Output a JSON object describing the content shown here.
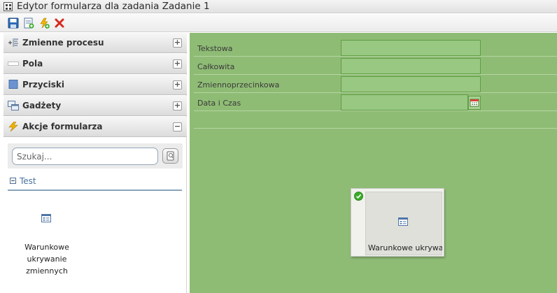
{
  "window": {
    "title": "Edytor formularza dla zadania Zadanie 1"
  },
  "toolbar": {
    "buttons": [
      {
        "icon": "save-icon"
      },
      {
        "icon": "new-form-icon"
      },
      {
        "icon": "add-action-icon"
      },
      {
        "icon": "delete-icon"
      }
    ]
  },
  "sidebar": {
    "sections": [
      {
        "label": "Zmienne procesu",
        "toggle": "+",
        "icon": "process-variables-icon"
      },
      {
        "label": "Pola",
        "toggle": "+",
        "icon": "field-icon"
      },
      {
        "label": "Przyciski",
        "toggle": "+",
        "icon": "button-square-icon"
      },
      {
        "label": "Gadżety",
        "toggle": "+",
        "icon": "gadgets-icon"
      },
      {
        "label": "Akcje formularza",
        "toggle": "−",
        "icon": "lightning-icon"
      }
    ],
    "search": {
      "placeholder": "Szukaj..."
    },
    "tree": {
      "group_label": "Test"
    },
    "tool_item": {
      "label": "Warunkowe ukrywanie zmiennych"
    }
  },
  "canvas": {
    "fields": [
      {
        "label": "Tekstowa",
        "value": ""
      },
      {
        "label": "Całkowita",
        "value": ""
      },
      {
        "label": "Zmiennoprzecinkowa",
        "value": ""
      },
      {
        "label": "Data i Czas",
        "value": ""
      }
    ],
    "widget": {
      "label": "Warunkowe ukrywanie zmiennych"
    }
  },
  "colors": {
    "canvas_bg": "#8fbc75",
    "field_bg": "#99c882",
    "accent_blue": "#4a73a0"
  }
}
